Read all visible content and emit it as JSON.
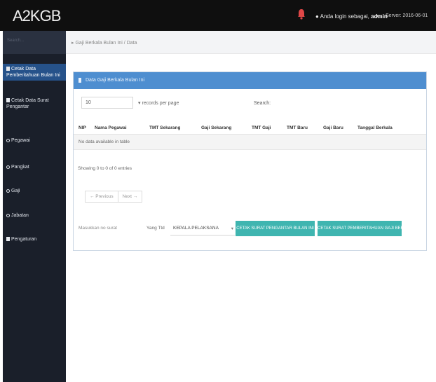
{
  "app": {
    "brand": "A2KGB"
  },
  "header": {
    "user_prefix": "Anda login sebagai,",
    "user_name": "admin",
    "caret": "▾",
    "server_text": "Server: 2016-06-01"
  },
  "sidebar": {
    "search_placeholder": "Search...",
    "items": [
      {
        "label": "Cetak Data Pemberitahuan Bulan Ini",
        "icon": "document-icon",
        "active": true
      },
      {
        "label": "Cetak Data Surat Pengantar",
        "icon": "document-icon",
        "active": false
      },
      {
        "label": "Pegawai",
        "icon": "circle-icon",
        "active": false
      },
      {
        "label": "Pangkat",
        "icon": "circle-icon",
        "active": false
      },
      {
        "label": "Gaji",
        "icon": "circle-icon",
        "active": false
      },
      {
        "label": "Jabatan",
        "icon": "circle-icon",
        "active": false
      },
      {
        "label": "Pengaturan",
        "icon": "gear-icon",
        "active": false
      }
    ]
  },
  "breadcrumb": {
    "text": "▸ Gaji Berkala Bulan Ini / Data"
  },
  "panel": {
    "title": "Data Gaji Berkala Bulan Ini",
    "length_value": "10",
    "length_label": "▾ records per page",
    "search_label": "Search:",
    "columns": [
      "NIP",
      "Nama Pegawai",
      "TMT Sekarang",
      "Gaji Sekarang",
      "TMT Gaji",
      "TMT Baru",
      "Gaji Baru",
      "Tanggal Berkala"
    ],
    "empty_message": "No data available in table",
    "info_text": "Showing 0 to 0 of 0 entries",
    "pager": {
      "prev": "← Previous",
      "next": "Next →"
    },
    "date_placeholder": "Masukkan no surat",
    "ttd_label": "Yang Ttd",
    "ttd_value": "KEPALA PELAKSANA",
    "ttd_caret": "▾",
    "btn_cetak_surat": "CETAK SURAT PENGANTAR BULAN INI",
    "btn_cetak_pemberitahuan": "CETAK SURAT PEMBERITAHUAN GAJI BERKALA"
  },
  "colors": {
    "topbar": "#0f0f0f",
    "sidebar": "#1a1f2a",
    "sidebar_active": "#26528a",
    "panel_header": "#4e8ed0",
    "button_teal": "#3fb5b0",
    "bell": "#e04747"
  }
}
